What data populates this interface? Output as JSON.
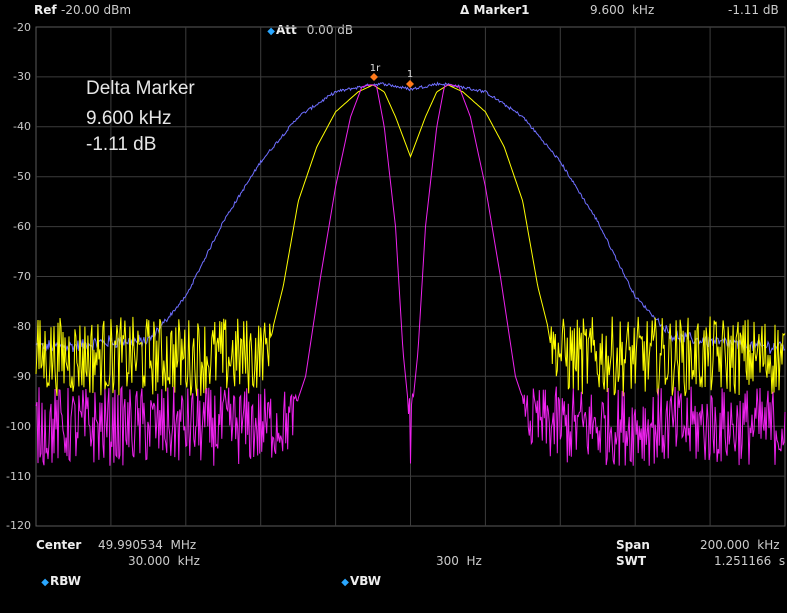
{
  "top_bar": {
    "ref_label": "Ref",
    "ref_value": "-20.00 dBm",
    "att_label": "Att",
    "att_value": "0.00 dB",
    "marker_label": "Δ Marker1",
    "marker_freq": "9.600  kHz",
    "marker_level": "-1.11 dB"
  },
  "delta_box": {
    "title": "Delta Marker",
    "freq": "9.600  kHz",
    "level": "-1.11 dB"
  },
  "markers": {
    "ref_label": "1r",
    "delta_label": "1"
  },
  "bottom_bar": {
    "center_label": "Center",
    "center_value": "49.990534  MHz",
    "span_label": "Span",
    "span_value": "200.000  kHz",
    "rbw_label": "RBW",
    "rbw_value": "30.000  kHz",
    "vbw_label": "VBW",
    "vbw_value": "300  Hz",
    "swt_label": "SWT",
    "swt_value": "1.251166  s"
  },
  "chart_data": {
    "type": "line",
    "y_ticks": [
      "-20",
      "-30",
      "-40",
      "-50",
      "-60",
      "-70",
      "-80",
      "-90",
      "-100",
      "-110",
      "-120"
    ],
    "ylim": [
      -120,
      -20
    ],
    "xlim_khz": [
      -100,
      100
    ],
    "grid": true,
    "series": [
      {
        "color": "#6f6fff",
        "x": [
          -100,
          -90,
          -80,
          -70,
          -60,
          -50,
          -40,
          -30,
          -20,
          -10,
          -7,
          0,
          7,
          10,
          20,
          30,
          40,
          50,
          60,
          70,
          80,
          90,
          100
        ],
        "y": [
          -84,
          -84,
          -83,
          -83,
          -74,
          -59,
          -47,
          -38,
          -33,
          -31.5,
          -31.4,
          -32.5,
          -31.4,
          -31.5,
          -33,
          -38,
          -47,
          -59,
          -74,
          -82,
          -83,
          -84,
          -84
        ]
      },
      {
        "color": "#ffff00",
        "x": [
          -100,
          -60,
          -50,
          -42,
          -38,
          -34,
          -30,
          -25,
          -20,
          -14,
          -10,
          -7,
          -4,
          -2,
          0,
          2,
          4,
          7,
          10,
          14,
          20,
          25,
          30,
          34,
          38,
          42,
          50,
          60,
          100
        ],
        "y": [
          -86,
          -86,
          -86,
          -86,
          -84,
          -72,
          -55,
          -44,
          -37,
          -33,
          -31.6,
          -33,
          -38,
          -42,
          -46,
          -42,
          -38,
          -33,
          -31.6,
          -33,
          -37,
          -44,
          -55,
          -72,
          -84,
          -86,
          -86,
          -86,
          -86
        ]
      },
      {
        "color": "#ee22ee",
        "x": [
          -100,
          -40,
          -32,
          -28,
          -24,
          -20,
          -16,
          -13,
          -11,
          -10,
          -9,
          -7,
          -4,
          -2,
          0,
          2,
          4,
          7,
          9,
          10,
          11,
          13,
          16,
          20,
          24,
          28,
          32,
          40,
          100
        ],
        "y": [
          -100,
          -100,
          -99,
          -90,
          -70,
          -52,
          -38,
          -32,
          -31.6,
          -31.6,
          -32,
          -40,
          -60,
          -85,
          -100,
          -85,
          -60,
          -40,
          -32,
          -31.6,
          -31.6,
          -32,
          -38,
          -52,
          -70,
          -90,
          -99,
          -100,
          -100
        ]
      }
    ]
  }
}
